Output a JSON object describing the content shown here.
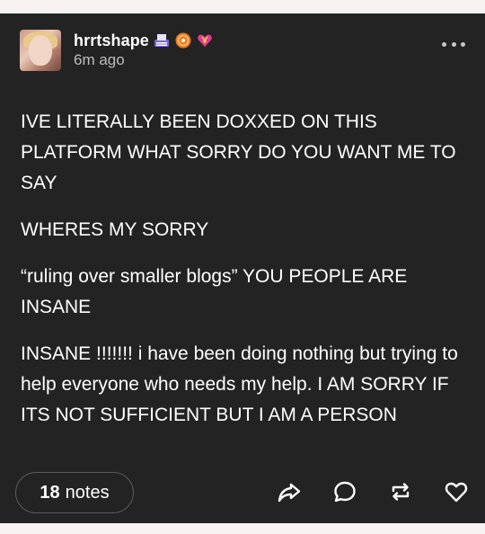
{
  "post": {
    "username": "hrrtshape",
    "timestamp": "6m ago",
    "badges": [
      "typewriter-icon",
      "orange-badge-icon",
      "heart-gem-icon"
    ],
    "paragraphs": [
      "IVE LITERALLY BEEN DOXXED ON THIS PLATFORM WHAT SORRY DO YOU WANT ME TO SAY",
      "WHERES MY SORRY",
      "“ruling over smaller blogs” YOU PEOPLE ARE INSANE",
      "INSANE !!!!!!! i have been doing nothing but trying to help everyone who needs my help. I AM SORRY IF ITS NOT SUFFICIENT BUT I AM A PERSON"
    ],
    "notes_count": "18",
    "notes_label": "notes",
    "actions": [
      "share-icon",
      "reply-icon",
      "reblog-icon",
      "like-icon"
    ]
  },
  "colors": {
    "page_background": "#f7f3f2",
    "post_background": "#232323",
    "text": "#ffffff",
    "muted_text": "#bdbdbd"
  }
}
